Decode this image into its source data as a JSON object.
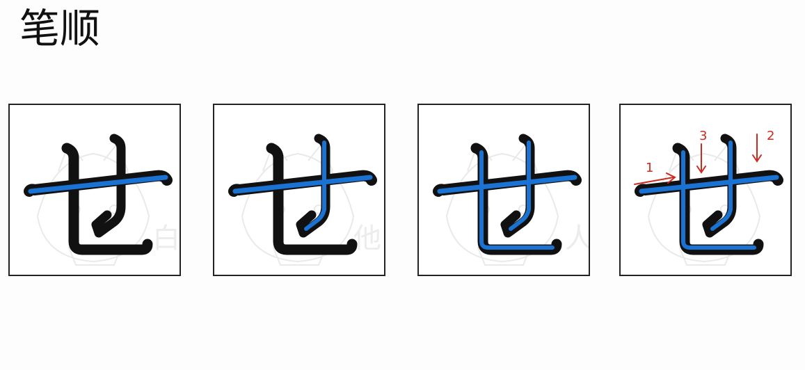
{
  "title": "笔顺",
  "colors": {
    "stroke_black": "#111111",
    "stroke_blue": "#1a73d2",
    "annotation_red": "#cc2a1f",
    "watermark": "#e6e6e6"
  },
  "watermark_chars": [
    "白",
    "他",
    "人"
  ],
  "frames": [
    {
      "step": 1,
      "highlighted_strokes": 1
    },
    {
      "step": 2,
      "highlighted_strokes": 2
    },
    {
      "step": 3,
      "highlighted_strokes": 3
    },
    {
      "step": 4,
      "highlighted_strokes": 3,
      "annotations": [
        "1",
        "2",
        "3"
      ]
    }
  ]
}
